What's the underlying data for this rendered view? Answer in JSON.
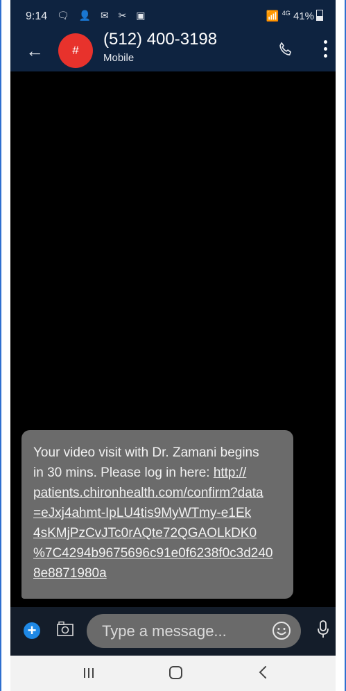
{
  "status_bar": {
    "time": "9:14",
    "notification_icons": "🗨 👤 ✉ ✂ ▣",
    "network": "4G",
    "battery": "41%"
  },
  "header": {
    "avatar_letter": "#",
    "contact": "(512) 400-3198",
    "subtitle": "Mobile"
  },
  "message": {
    "lines": [
      "Your video visit with Dr. Zamani begins",
      "in 30 mins. Please log in here: "
    ],
    "link_lines": [
      "http://",
      "patients.chironhealth.com/confirm?data",
      "=eJxj4ahmt-IpLU4tis9MyWTmy-e1Ek",
      "4sKMjPzCvJTc0rAQte72QGAOLkDK0",
      "%7C4294b9675696c91e0f6238f0c3d240",
      "8e8871980a"
    ]
  },
  "composer": {
    "placeholder": "Type a message..."
  },
  "colors": {
    "header": "#0e2340",
    "avatar": "#e8322c",
    "bubble": "#6b6b6b",
    "accent": "#1e88e5"
  }
}
